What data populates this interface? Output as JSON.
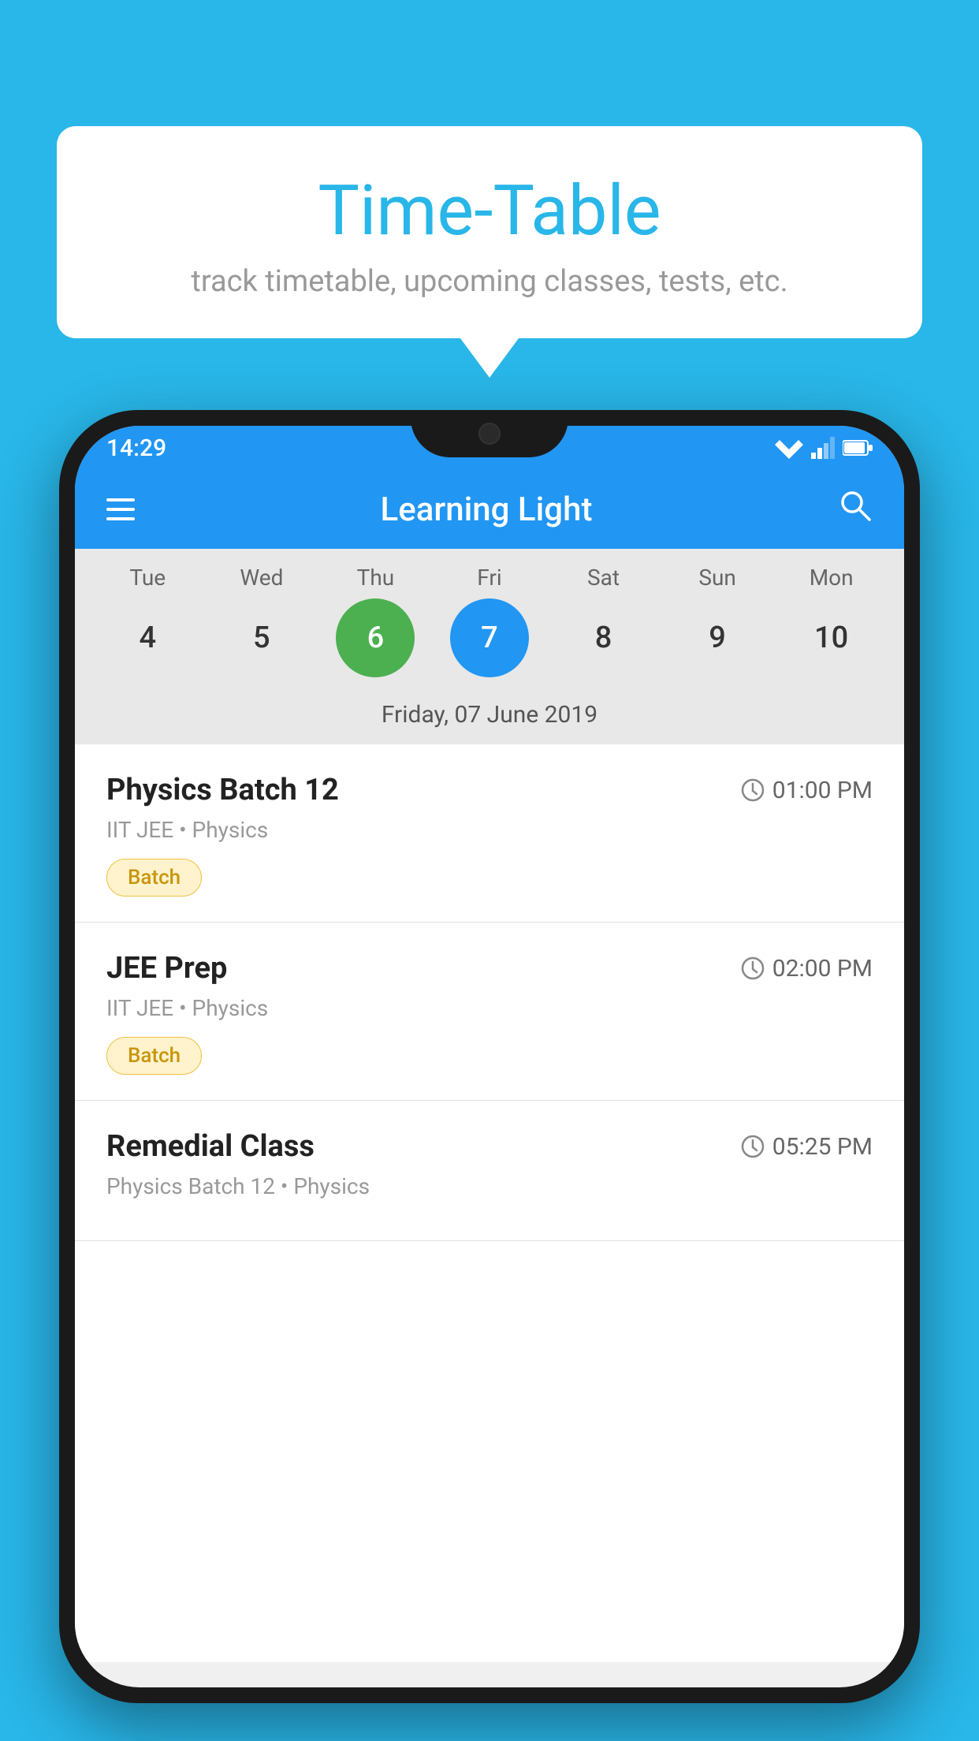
{
  "background": {
    "color": "#29B6E8"
  },
  "speech_bubble": {
    "title": "Time-Table",
    "subtitle": "track timetable, upcoming classes, tests, etc."
  },
  "phone": {
    "status_bar": {
      "time": "14:29"
    },
    "app_bar": {
      "title": "Learning Light"
    },
    "calendar": {
      "days": [
        {
          "label": "Tue",
          "num": "4"
        },
        {
          "label": "Wed",
          "num": "5"
        },
        {
          "label": "Thu",
          "num": "6",
          "state": "today"
        },
        {
          "label": "Fri",
          "num": "7",
          "state": "selected"
        },
        {
          "label": "Sat",
          "num": "8"
        },
        {
          "label": "Sun",
          "num": "9"
        },
        {
          "label": "Mon",
          "num": "10"
        }
      ],
      "selected_date_label": "Friday, 07 June 2019"
    },
    "classes": [
      {
        "name": "Physics Batch 12",
        "time": "01:00 PM",
        "subtitle": "IIT JEE • Physics",
        "badge": "Batch"
      },
      {
        "name": "JEE Prep",
        "time": "02:00 PM",
        "subtitle": "IIT JEE • Physics",
        "badge": "Batch"
      },
      {
        "name": "Remedial Class",
        "time": "05:25 PM",
        "subtitle": "Physics Batch 12 • Physics",
        "badge": null
      }
    ]
  }
}
